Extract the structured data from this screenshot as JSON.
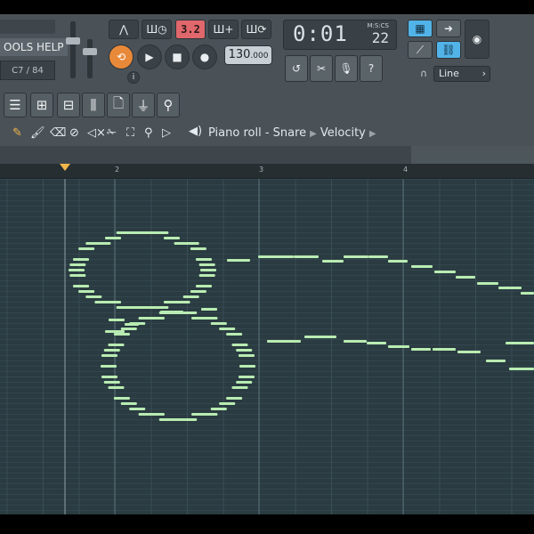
{
  "menu": {
    "label": "OOLS  HELP"
  },
  "hint": {
    "label": "C7 / 84"
  },
  "pattern_counter": "3.2",
  "tempo": {
    "value": "130",
    "decimals": ".000"
  },
  "time": {
    "main": "0:01",
    "seconds": "22",
    "label": "M:S:CS"
  },
  "snap": {
    "label": "Line"
  },
  "piano_roll": {
    "breadcrumb": [
      "Piano roll - Snare",
      "Velocity"
    ]
  },
  "ruler": {
    "bars": [
      "2",
      "3",
      "4"
    ]
  },
  "icons": {
    "pencil": "pencil-icon",
    "paint": "brush-icon",
    "delete": "eraser-icon",
    "mute": "mute-icon",
    "slice": "slice-icon",
    "select": "select-icon",
    "zoom": "zoom-icon",
    "playback": "playback-icon",
    "speaker": "speaker-icon"
  },
  "colors": {
    "grid_bg": "#2a3b41",
    "note": "#b9ecb2",
    "accent_orange": "#e8893a",
    "accent_blue": "#52b3e8",
    "pattern_red": "#e0676b"
  }
}
